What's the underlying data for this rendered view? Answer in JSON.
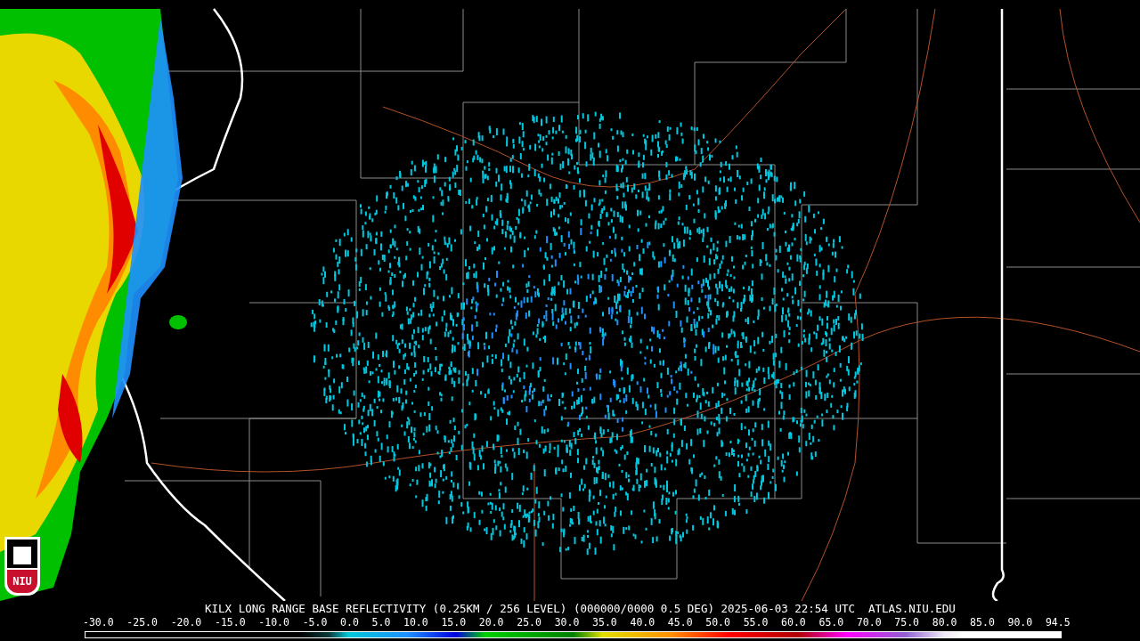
{
  "logo": {
    "text": "NIU"
  },
  "caption": "KILX LONG RANGE BASE REFLECTIVITY (0.25KM / 256 LEVEL) (000000/0000 0.5 DEG) 2025-06-03 22:54 UTC  ATLAS.NIU.EDU",
  "scale_labels": [
    "-30.0",
    "-25.0",
    "-20.0",
    "-15.0",
    "-10.0",
    "-5.0",
    "0.0",
    "5.0",
    "10.0",
    "15.0",
    "20.0",
    "25.0",
    "30.0",
    "35.0",
    "40.0",
    "45.0",
    "50.0",
    "55.0",
    "60.0",
    "65.0",
    "70.0",
    "75.0",
    "80.0",
    "85.0",
    "90.0",
    "94.5"
  ]
}
